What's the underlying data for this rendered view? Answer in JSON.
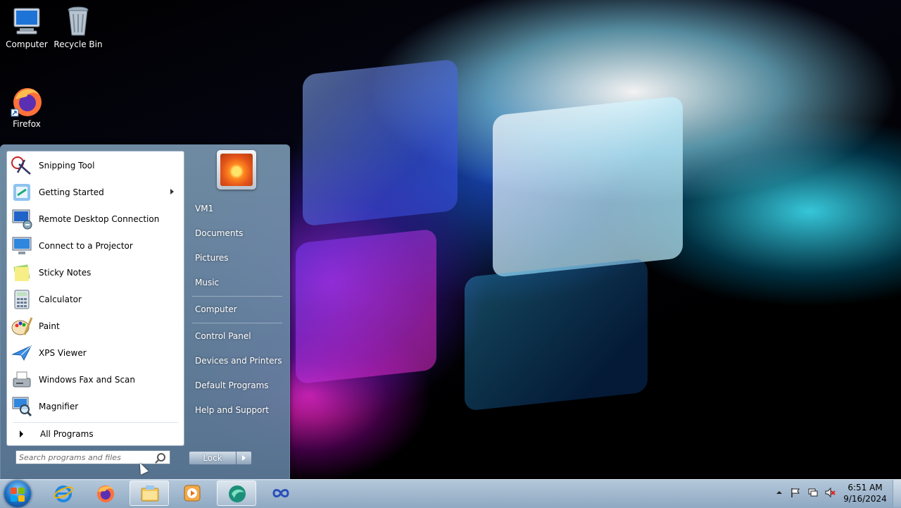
{
  "desktop": {
    "icons": [
      {
        "label": "Computer",
        "icon": "computer-icon"
      },
      {
        "label": "Recycle Bin",
        "icon": "recycle-bin-icon"
      },
      {
        "label": "Firefox",
        "icon": "firefox-icon"
      }
    ]
  },
  "start_menu": {
    "programs": [
      {
        "label": "Snipping Tool",
        "icon": "snipping-tool-icon"
      },
      {
        "label": "Getting Started",
        "icon": "getting-started-icon",
        "has_submenu": true
      },
      {
        "label": "Remote Desktop Connection",
        "icon": "remote-desktop-icon"
      },
      {
        "label": "Connect to a Projector",
        "icon": "projector-icon"
      },
      {
        "label": "Sticky Notes",
        "icon": "sticky-notes-icon"
      },
      {
        "label": "Calculator",
        "icon": "calculator-icon"
      },
      {
        "label": "Paint",
        "icon": "paint-icon"
      },
      {
        "label": "XPS Viewer",
        "icon": "xps-viewer-icon"
      },
      {
        "label": "Windows Fax and Scan",
        "icon": "fax-scan-icon"
      },
      {
        "label": "Magnifier",
        "icon": "magnifier-icon"
      }
    ],
    "all_programs_label": "All Programs",
    "search_placeholder": "Search programs and files",
    "right_items": [
      {
        "label": "VM1"
      },
      {
        "label": "Documents"
      },
      {
        "label": "Pictures"
      },
      {
        "label": "Music"
      },
      {
        "label": "Computer"
      },
      {
        "label": "Control Panel"
      },
      {
        "label": "Devices and Printers"
      },
      {
        "label": "Default Programs"
      },
      {
        "label": "Help and Support"
      }
    ],
    "lock_label": "Lock"
  },
  "taskbar": {
    "pinned": [
      {
        "icon": "internet-explorer-icon"
      },
      {
        "icon": "firefox-icon"
      },
      {
        "icon": "file-explorer-icon",
        "active": true
      },
      {
        "icon": "media-player-icon"
      },
      {
        "icon": "app-icon",
        "active": true
      },
      {
        "icon": "infinity-app-icon"
      }
    ],
    "clock_time": "6:51 AM",
    "clock_date": "9/16/2024"
  }
}
